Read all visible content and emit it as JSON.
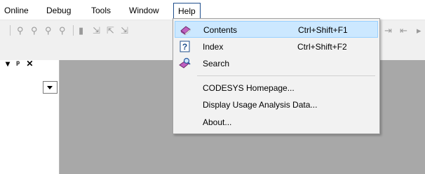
{
  "menubar": {
    "items": [
      {
        "label": "Online"
      },
      {
        "label": "Debug"
      },
      {
        "label": "Tools"
      },
      {
        "label": "Window"
      },
      {
        "label": "Help"
      }
    ]
  },
  "panel": {
    "dropdown_icon": "chevron-down-icon",
    "header_icons": [
      "chevron-down-icon",
      "pin-icon",
      "close-icon"
    ]
  },
  "help_menu": {
    "items": [
      {
        "label": "Contents",
        "shortcut": "Ctrl+Shift+F1",
        "icon": "book-icon",
        "highlighted": true
      },
      {
        "label": "Index",
        "shortcut": "Ctrl+Shift+F2",
        "icon": "help-index-icon"
      },
      {
        "label": "Search",
        "shortcut": "",
        "icon": "search-book-icon"
      },
      {
        "label": "CODESYS Homepage...",
        "shortcut": ""
      },
      {
        "label": "Display Usage Analysis Data...",
        "shortcut": ""
      },
      {
        "label": "About...",
        "shortcut": ""
      }
    ]
  },
  "colors": {
    "highlight_bg": "#cce8ff",
    "highlight_border": "#99d1ff",
    "workspace": "#a8a8a8"
  }
}
